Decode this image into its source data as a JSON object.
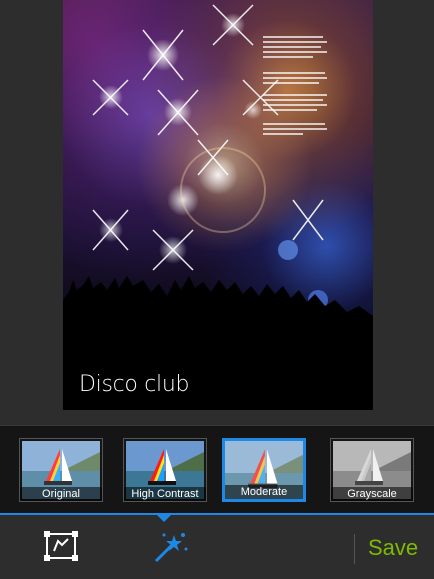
{
  "poster": {
    "title": "Disco club"
  },
  "filters": {
    "items": [
      {
        "label": "Original",
        "selected": false,
        "mode": "color"
      },
      {
        "label": "High Contrast",
        "selected": false,
        "mode": "contrast"
      },
      {
        "label": "Moderate",
        "selected": true,
        "mode": "moderate"
      },
      {
        "label": "Grayscale",
        "selected": false,
        "mode": "gray"
      }
    ]
  },
  "toolbar": {
    "crop_icon": "crop-icon",
    "effects_icon": "magic-wand-icon",
    "save_label": "Save"
  },
  "colors": {
    "accent": "#1e88e5",
    "save": "#7fba00",
    "background": "#2d2d2d",
    "strip": "#151515"
  }
}
